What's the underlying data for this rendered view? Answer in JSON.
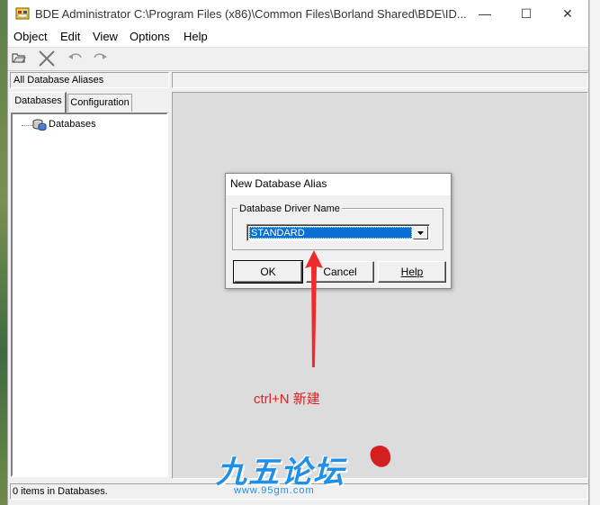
{
  "window": {
    "title": "BDE Administrator  C:\\Program Files (x86)\\Common Files\\Borland Shared\\BDE\\ID..."
  },
  "menu": [
    "Object",
    "Edit",
    "View",
    "Options",
    "Help"
  ],
  "toolbar_icons": [
    "open-folder-icon",
    "delete-x-icon",
    "undo-icon",
    "redo-icon"
  ],
  "left_pane": {
    "header": "All Database Aliases",
    "tabs": [
      "Databases",
      "Configuration"
    ],
    "active_tab": "Databases",
    "tree_root": "Databases"
  },
  "status": "0 items in Databases.",
  "dialog": {
    "title": "New Database Alias",
    "group_label": "Database Driver Name",
    "driver_selected": "STANDARD",
    "ok": "OK",
    "cancel": "Cancel",
    "help": "Help"
  },
  "annotation": {
    "text": "ctrl+N  新建",
    "color": "#e02020"
  },
  "watermark": {
    "text": "九五论坛",
    "url": "www.95gm.com",
    "color": "#1f8fe8"
  },
  "colors": {
    "selection": "#0a6fd1",
    "window_bg": "#f0f0f0"
  }
}
